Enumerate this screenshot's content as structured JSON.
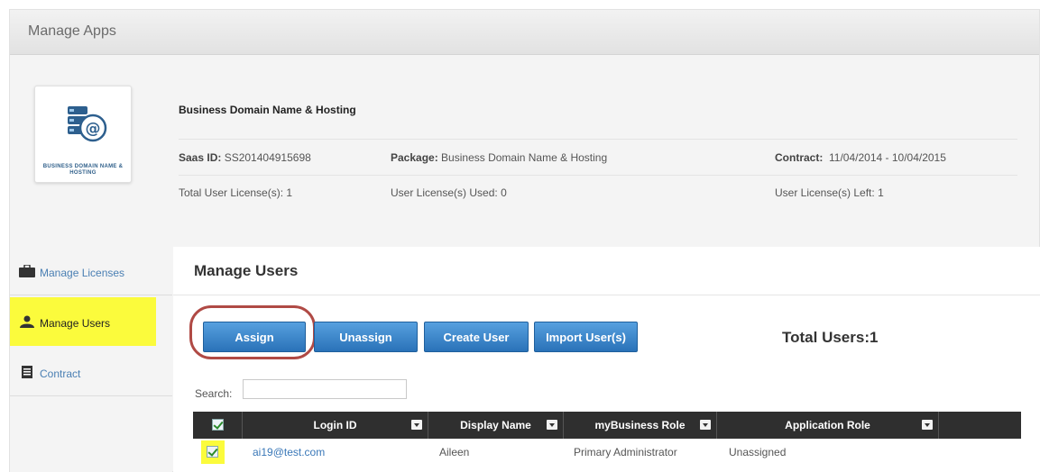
{
  "header": {
    "title": "Manage Apps"
  },
  "app": {
    "logo_caption": "BUSINESS DOMAIN NAME & HOSTING",
    "name": "Business Domain Name & Hosting",
    "saas_id_label": "Saas ID:",
    "saas_id": "SS201404915698",
    "package_label": "Package:",
    "package": "Business Domain Name & Hosting",
    "contract_label": "Contract:",
    "contract": "11/04/2014 - 10/04/2015",
    "total_licenses_label": "Total User License(s):",
    "total_licenses": "1",
    "licenses_used_label": "User License(s) Used:",
    "licenses_used": "0",
    "licenses_left_label": "User License(s) Left:",
    "licenses_left": "1"
  },
  "sidebar": {
    "items": [
      {
        "label": "Manage Licenses",
        "icon": "briefcase-icon",
        "active": false
      },
      {
        "label": "Manage Users",
        "icon": "user-icon",
        "active": true
      },
      {
        "label": "Contract",
        "icon": "document-icon",
        "active": false
      }
    ]
  },
  "main": {
    "title": "Manage Users",
    "buttons": {
      "assign": "Assign",
      "unassign": "Unassign",
      "create_user": "Create User",
      "import_users": "Import User(s)"
    },
    "total_users_label": "Total Users:",
    "total_users": "1",
    "search_label": "Search:",
    "search_value": ""
  },
  "table": {
    "columns": [
      "Login ID",
      "Display Name",
      "myBusiness Role",
      "Application Role"
    ],
    "rows": [
      {
        "checked": true,
        "login_id": "ai19@test.com",
        "display_name": "Aileen",
        "mybusiness_role": "Primary Administrator",
        "application_role": "Unassigned"
      }
    ]
  },
  "colors": {
    "button": "#2a72b8",
    "highlight": "#fbfb3c",
    "annotation_ring": "#b04a45",
    "table_header": "#2f2f2f"
  }
}
